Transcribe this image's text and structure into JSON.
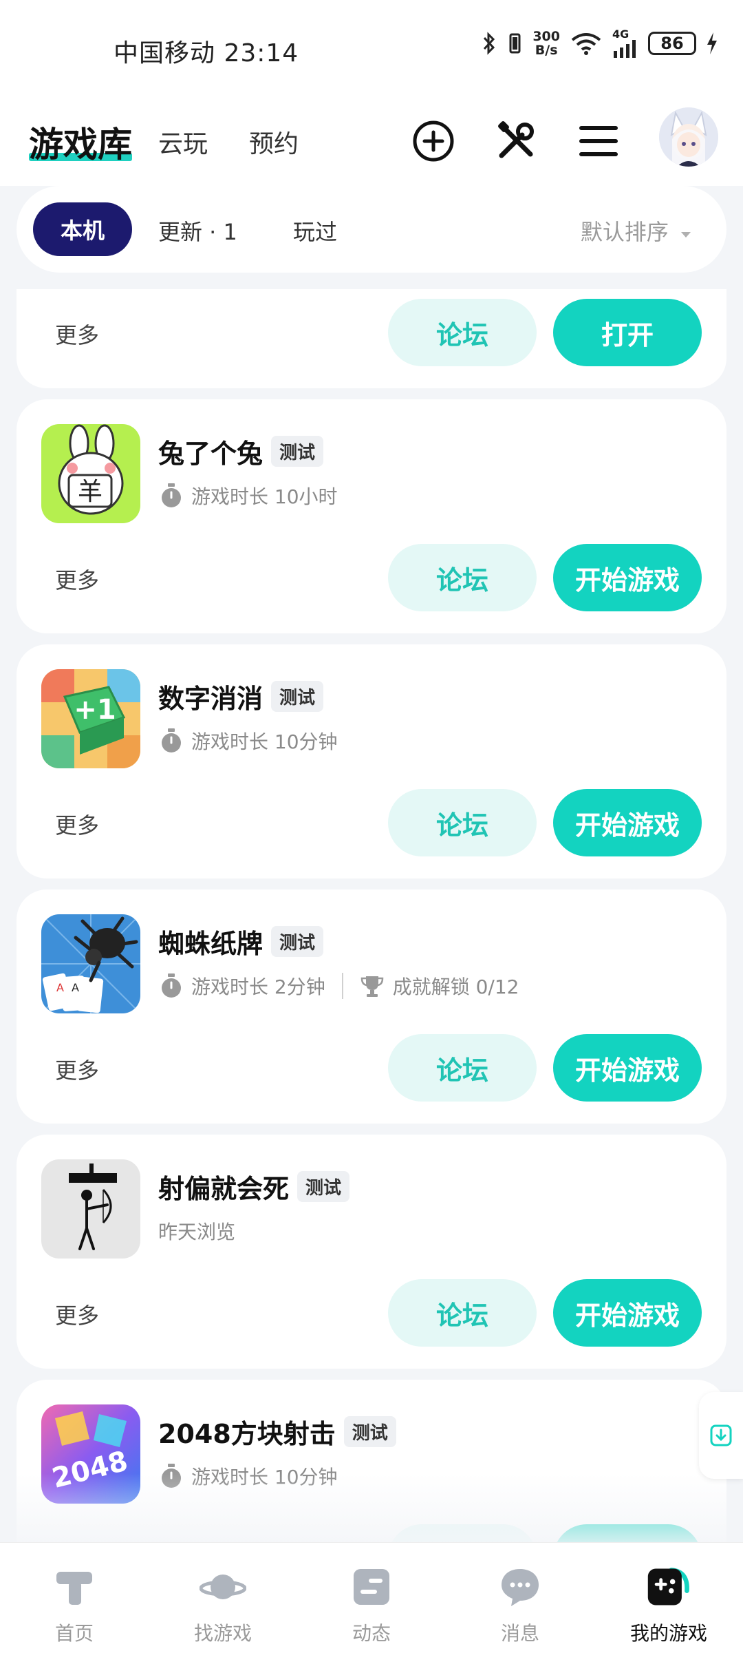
{
  "status_bar": {
    "carrier_time": "中国移动 23:14",
    "net_speed_value": "300",
    "net_speed_unit": "B/s",
    "network": "4G",
    "battery": "86"
  },
  "header": {
    "tabs": [
      {
        "label": "游戏库",
        "active": true
      },
      {
        "label": "云玩",
        "active": false
      },
      {
        "label": "预约",
        "active": false
      }
    ],
    "icons": [
      "add-circle-icon",
      "tools-icon",
      "menu-icon",
      "avatar"
    ]
  },
  "filters": {
    "active": "本机",
    "items": [
      "更新 · 1",
      "玩过"
    ],
    "sort_label": "默认排序"
  },
  "cards": [
    {
      "name": "",
      "more": "更多",
      "forum": "论坛",
      "action": "打开"
    },
    {
      "name": "兔了个兔",
      "badge": "测试",
      "playtime": "游戏时长 10小时",
      "more": "更多",
      "forum": "论坛",
      "action": "开始游戏"
    },
    {
      "name": "数字消消",
      "badge": "测试",
      "playtime": "游戏时长 10分钟",
      "more": "更多",
      "forum": "论坛",
      "action": "开始游戏"
    },
    {
      "name": "蜘蛛纸牌",
      "badge": "测试",
      "playtime": "游戏时长 2分钟",
      "achievement": "成就解锁 0/12",
      "more": "更多",
      "forum": "论坛",
      "action": "开始游戏"
    },
    {
      "name": "射偏就会死",
      "badge": "测试",
      "browsed": "昨天浏览",
      "more": "更多",
      "forum": "论坛",
      "action": "开始游戏"
    },
    {
      "name": "2048方块射击",
      "badge": "测试",
      "playtime": "游戏时长 10分钟"
    }
  ],
  "bottom_nav": [
    {
      "label": "首页",
      "icon": "home-icon"
    },
    {
      "label": "找游戏",
      "icon": "planet-icon"
    },
    {
      "label": "动态",
      "icon": "feed-icon"
    },
    {
      "label": "消息",
      "icon": "message-icon"
    },
    {
      "label": "我的游戏",
      "icon": "gamepad-icon",
      "active": true
    }
  ],
  "colors": {
    "accent": "#13d3c0",
    "forum_bg": "#e4f8f6",
    "filter_active": "#1c1a6e",
    "background": "#f3f5f8"
  }
}
